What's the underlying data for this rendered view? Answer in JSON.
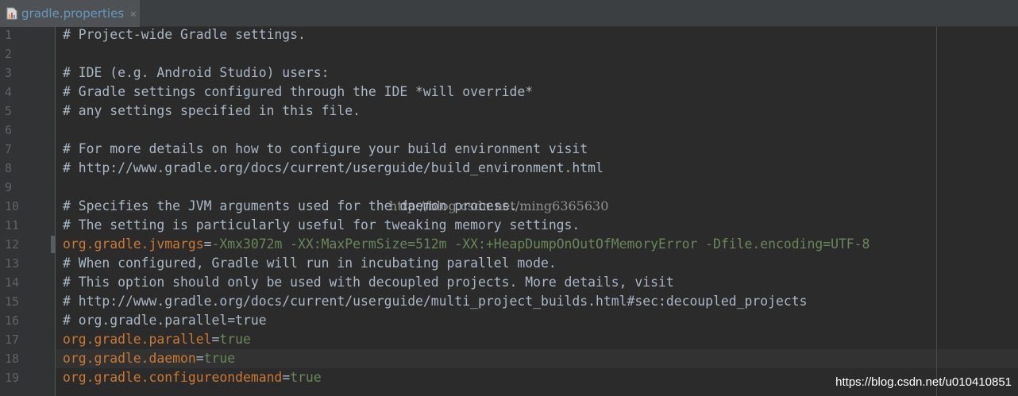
{
  "tab": {
    "filename": "gradle.properties",
    "close_glyph": "×",
    "icon": "properties-file-icon"
  },
  "gutter": {
    "line_numbers": [
      "1",
      "2",
      "3",
      "4",
      "5",
      "6",
      "7",
      "8",
      "9",
      "10",
      "11",
      "12",
      "13",
      "14",
      "15",
      "16",
      "17",
      "18",
      "19"
    ]
  },
  "lines": [
    [
      {
        "t": "c",
        "s": "# Project-wide Gradle settings."
      }
    ],
    [],
    [
      {
        "t": "c",
        "s": "# IDE (e.g. Android Studio) users:"
      }
    ],
    [
      {
        "t": "c",
        "s": "# Gradle settings configured through the IDE *will override*"
      }
    ],
    [
      {
        "t": "c",
        "s": "# any settings specified in this file."
      }
    ],
    [],
    [
      {
        "t": "c",
        "s": "# For more details on how to configure your build environment visit"
      }
    ],
    [
      {
        "t": "c",
        "s": "# http://www.gradle.org/docs/current/userguide/build_environment.html"
      }
    ],
    [],
    [
      {
        "t": "c",
        "s": "# Specifies the JVM arguments used for the daemon process."
      }
    ],
    [
      {
        "t": "c",
        "s": "# The setting is particularly useful for tweaking memory settings."
      }
    ],
    [
      {
        "t": "k",
        "s": "org.gradle.jvmargs"
      },
      {
        "t": "e",
        "s": "="
      },
      {
        "t": "v",
        "s": "-Xmx3072m -XX:MaxPermSize=512m -XX:+HeapDumpOnOutOfMemoryError -Dfile.encoding=UTF-8"
      }
    ],
    [
      {
        "t": "c",
        "s": "# When configured, Gradle will run in incubating parallel mode."
      }
    ],
    [
      {
        "t": "c",
        "s": "# This option should only be used with decoupled projects. More details, visit"
      }
    ],
    [
      {
        "t": "c",
        "s": "# http://www.gradle.org/docs/current/userguide/multi_project_builds.html#sec:decoupled_projects"
      }
    ],
    [
      {
        "t": "c",
        "s": "# org.gradle.parallel=true"
      }
    ],
    [
      {
        "t": "k",
        "s": "org.gradle.parallel"
      },
      {
        "t": "e",
        "s": "="
      },
      {
        "t": "v",
        "s": "true"
      }
    ],
    [
      {
        "t": "k",
        "s": "org.gradle.daemon"
      },
      {
        "t": "e",
        "s": "="
      },
      {
        "t": "v",
        "s": "true"
      }
    ],
    [
      {
        "t": "k",
        "s": "org.gradle.configureondemand"
      },
      {
        "t": "e",
        "s": "="
      },
      {
        "t": "v",
        "s": "true"
      }
    ]
  ],
  "current_line": 18,
  "marked_line": 12,
  "watermarks": {
    "center": "http://blog.csdn.net/ming6365630",
    "corner": "https://blog.csdn.net/u010410851"
  },
  "colors": {
    "background": "#2B2B2B",
    "gutter": "#313335",
    "tab_active": "#4E5254",
    "tab_text": "#6897BB",
    "comment": "#A9B7C6",
    "key": "#CC7832",
    "value": "#6A8759",
    "line_number": "#606366"
  }
}
